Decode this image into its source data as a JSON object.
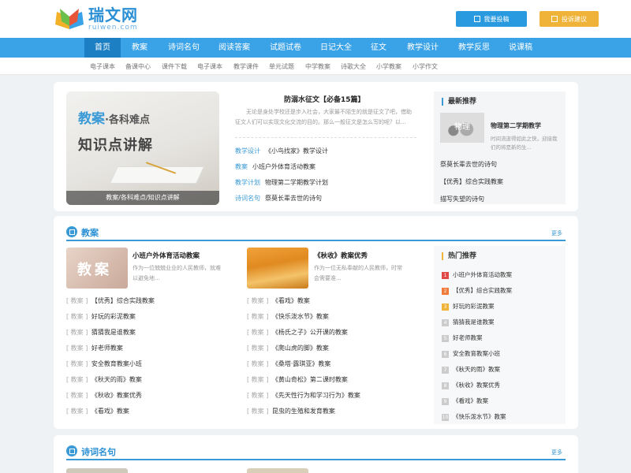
{
  "header": {
    "logo_text": "瑞文网",
    "logo_sub": "ruiwen.com",
    "btn_submit": "我要投稿",
    "btn_feedback": "投诉建议"
  },
  "nav": {
    "items": [
      "首页",
      "教案",
      "诗词名句",
      "阅读答案",
      "试题试卷",
      "日记大全",
      "征文",
      "教学设计",
      "教学反思",
      "说课稿"
    ]
  },
  "subnav": {
    "items": [
      "电子课本",
      "备课中心",
      "课件下载",
      "电子课本",
      "教学课件",
      "单元试题",
      "中学教案",
      "诗歌大全",
      "小学教案",
      "小学作文"
    ]
  },
  "featured": {
    "banner_title": "教案",
    "banner_title2": "·各科难点",
    "banner_line2": "知识点讲解",
    "banner_caption": "教案/各科难点/知识点讲解",
    "headline": "防溺水征文【必备15篇】",
    "desc": "无论是身处学校还是步入社会，大家最不陌生的就是征文了吧，借助征文人们可以实现文化交流的目的。那么一般征文是怎么写的呢？以...",
    "list": [
      {
        "tag": "教学设计",
        "text": "《小鸟找家》教学设计"
      },
      {
        "tag": "教案",
        "text": "小班户外体育活动教案"
      },
      {
        "tag": "教学计划",
        "text": "物理第二学期教学计划"
      },
      {
        "tag": "诗词名句",
        "text": "祭莫长辈去世的诗句"
      }
    ]
  },
  "latest": {
    "title": "最新推荐",
    "thumb_label": "物理",
    "item_title": "物理第二学期教学",
    "item_desc": "时间流逝得如此之快，迎接我们的将是新的生...",
    "list": [
      "祭莫长辈去世的诗句",
      "【优秀】综合实践教案",
      "描写失望的诗句"
    ]
  },
  "section_jiaoan": {
    "title": "教案",
    "more": "更多",
    "card1_img": "教案",
    "card1_title": "小班户外体育活动教案",
    "card1_desc": "作为一位兢兢业业的人民教师，就难以避免地...",
    "card2_title": "《秋收》教案优秀",
    "card2_desc": "作为一位无私奉献的人民教师，时常会需要准...",
    "col1": [
      {
        "tag": "教案",
        "text": "【优秀】综合实践教案"
      },
      {
        "tag": "教案",
        "text": "好玩的彩泥教案"
      },
      {
        "tag": "教案",
        "text": "猜猜我是谁教案"
      },
      {
        "tag": "教案",
        "text": "好老师教案"
      },
      {
        "tag": "教案",
        "text": "安全教育教案小班"
      },
      {
        "tag": "教案",
        "text": "《秋天的雨》教案"
      },
      {
        "tag": "教案",
        "text": "《秋收》教案优秀"
      },
      {
        "tag": "教案",
        "text": "《看戏》教案"
      }
    ],
    "col2": [
      {
        "tag": "教案",
        "text": "《看戏》教案"
      },
      {
        "tag": "教案",
        "text": "《快乐泼水节》教案"
      },
      {
        "tag": "教案",
        "text": "《杨氏之子》公开课的教案"
      },
      {
        "tag": "教案",
        "text": "《爬山虎的脚》教案"
      },
      {
        "tag": "教案",
        "text": "《桑塔·露琪亚》教案"
      },
      {
        "tag": "教案",
        "text": "《黄山奇松》第二课时教案"
      },
      {
        "tag": "教案",
        "text": "《先天性行为和学习行为》教案"
      },
      {
        "tag": "教案",
        "text": "昆虫的生殖和发育教案"
      }
    ]
  },
  "hot": {
    "title": "热门推荐",
    "list": [
      "小班户外体育活动教案",
      "【优秀】综合实践教案",
      "好玩的彩泥教案",
      "猜猜我是谁教案",
      "好老师教案",
      "安全教育教案小班",
      "《秋天的雨》教案",
      "《秋收》教案优秀",
      "《看戏》教案",
      "《快乐泼水节》教案"
    ]
  },
  "section_shici": {
    "title": "诗词名句",
    "more": "更多"
  }
}
